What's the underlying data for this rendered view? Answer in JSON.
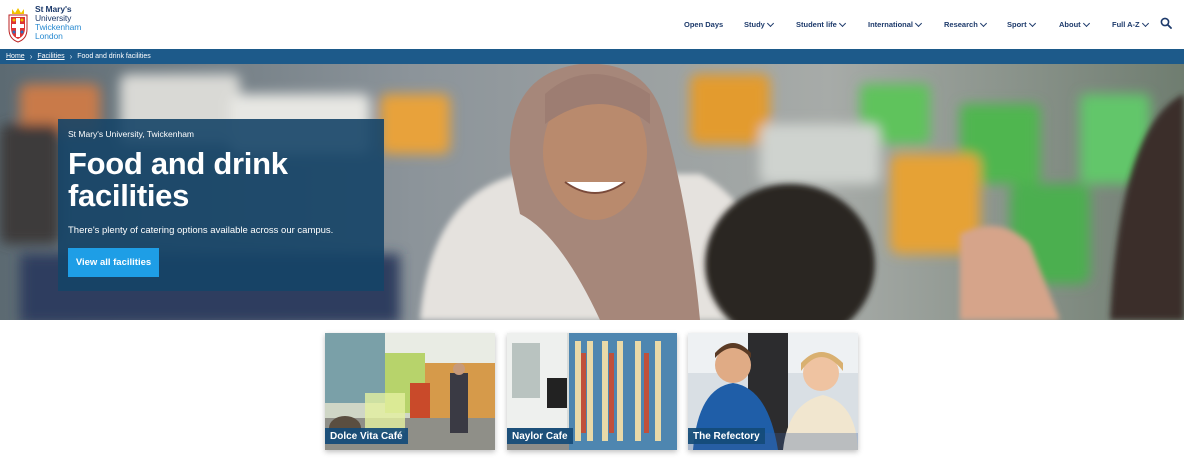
{
  "logo": {
    "line1": "St Mary's",
    "line2": "University",
    "line3": "Twickenham",
    "line4": "London"
  },
  "nav": {
    "items": [
      {
        "label": "Open Days",
        "dropdown": false
      },
      {
        "label": "Study",
        "dropdown": true
      },
      {
        "label": "Student life",
        "dropdown": true
      },
      {
        "label": "International",
        "dropdown": true
      },
      {
        "label": "Research",
        "dropdown": true
      },
      {
        "label": "Sport",
        "dropdown": true
      },
      {
        "label": "About",
        "dropdown": true
      },
      {
        "label": "Full A-Z",
        "dropdown": true
      }
    ],
    "search_icon": "search-icon"
  },
  "breadcrumb": {
    "items": [
      "Home",
      "Facilities",
      "Food and drink facilities"
    ]
  },
  "hero": {
    "kicker": "St Mary's University, Twickenham",
    "title": "Food and drink facilities",
    "description": "There's plenty of catering options available across our campus.",
    "button_label": "View all facilities"
  },
  "cards": [
    {
      "label": "Dolce Vita Café"
    },
    {
      "label": "Naylor Cafe"
    },
    {
      "label": "The Refectory"
    }
  ],
  "colors": {
    "brand_navy": "#1d3a6b",
    "breadcrumb_bar": "#1d5a8a",
    "hero_panel": "#154467",
    "button_blue": "#1e9ee6",
    "logo_light_blue": "#2a8bd1"
  }
}
